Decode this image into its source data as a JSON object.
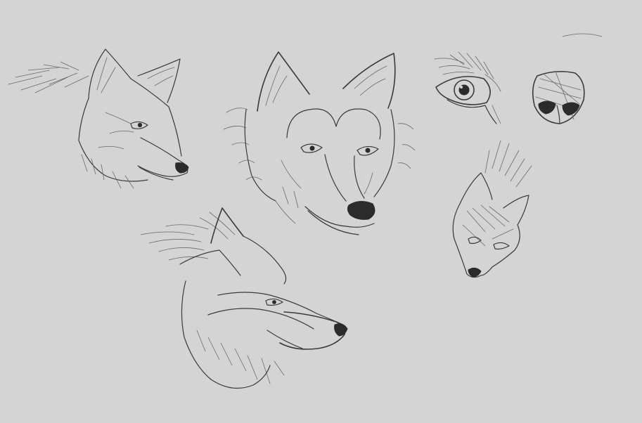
{
  "canvas": {
    "background": "#d4d4d4",
    "stroke_color": "#3a3a3a"
  },
  "sketches": [
    {
      "name": "wolf-head-three-quarter"
    },
    {
      "name": "wolf-head-front"
    },
    {
      "name": "wolf-eye-study"
    },
    {
      "name": "wolf-nose-study"
    },
    {
      "name": "fox-head-small"
    },
    {
      "name": "wolf-head-profile"
    }
  ]
}
